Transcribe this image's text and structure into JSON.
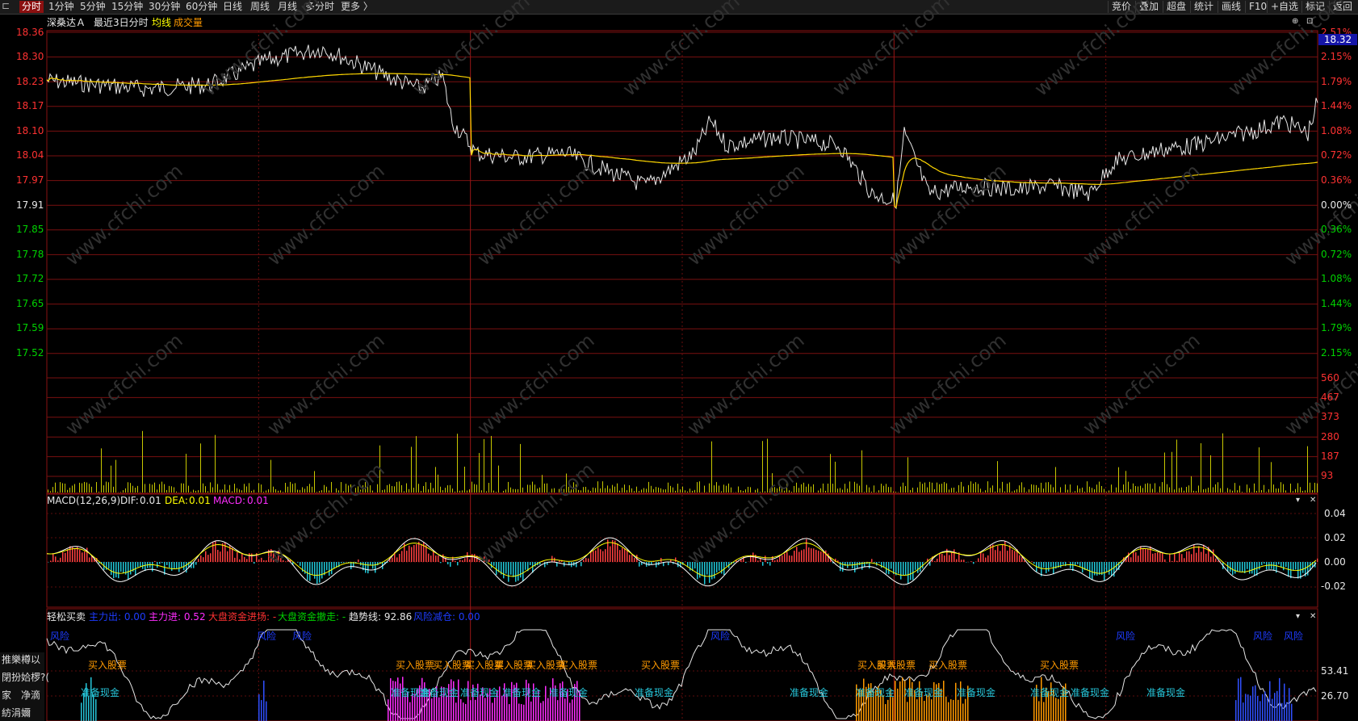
{
  "toolbar": {
    "tabs": [
      "分时",
      "1分钟",
      "5分钟",
      "15分钟",
      "30分钟",
      "60分钟",
      "日线",
      "周线",
      "月线",
      "多分时",
      "更多 〉"
    ],
    "active_tab": "分时",
    "right_buttons": [
      "竞价",
      "叠加",
      "超盘",
      "统计",
      "画线",
      "F10",
      "+自选",
      "标记",
      "返回"
    ]
  },
  "main_chart": {
    "stock_name": "深桑达Ａ",
    "period": "最近3日分时",
    "avg_line_label": "均线",
    "volume_label": "成交量",
    "current_price": "18.32",
    "price_ticks_up": [
      "18.36",
      "18.30",
      "18.23",
      "18.17",
      "18.10",
      "18.04",
      "17.97"
    ],
    "price_tick_base": "17.91",
    "price_ticks_down": [
      "17.85",
      "17.78",
      "17.72",
      "17.65",
      "17.59",
      "17.52"
    ],
    "pct_ticks_up": [
      "2.51%",
      "2.15%",
      "1.79%",
      "1.44%",
      "1.08%",
      "0.72%",
      "0.36%"
    ],
    "pct_tick_base": "0.00%",
    "pct_ticks_down": [
      "0.36%",
      "0.72%",
      "1.08%",
      "1.44%",
      "1.79%",
      "2.15%"
    ],
    "volume_ticks": [
      "560",
      "467",
      "373",
      "280",
      "187",
      "93"
    ],
    "watermark": "www.cfchi.com"
  },
  "macd": {
    "title": "MACD(12,26,9)",
    "dif_label": "DIF:",
    "dif_value": "0.01",
    "dea_label": "DEA:",
    "dea_value": "0.01",
    "macd_label": "MACD:",
    "macd_value": "0.01",
    "ticks": [
      "0.04",
      "0.02",
      "0.00",
      "-0.02"
    ]
  },
  "qsmm": {
    "title": "轻松买卖",
    "main_out": "主力出: 0.00",
    "main_in": "主力进: 0.52",
    "market_in": "大盘资金进场: -",
    "market_out": "大盘资金撤走: -",
    "trend": "趋势线: 92.86",
    "risk": "风险减仓: 0.00",
    "ticks": [
      "53.41",
      "26.70"
    ],
    "buy_label": "买入股票",
    "cash_label": "准备现金",
    "risk_label": "风险"
  },
  "left_panel": [
    "推樂樽以",
    "閉扮姶椤?(",
    "家　净滴",
    "紡涓嬭"
  ]
}
